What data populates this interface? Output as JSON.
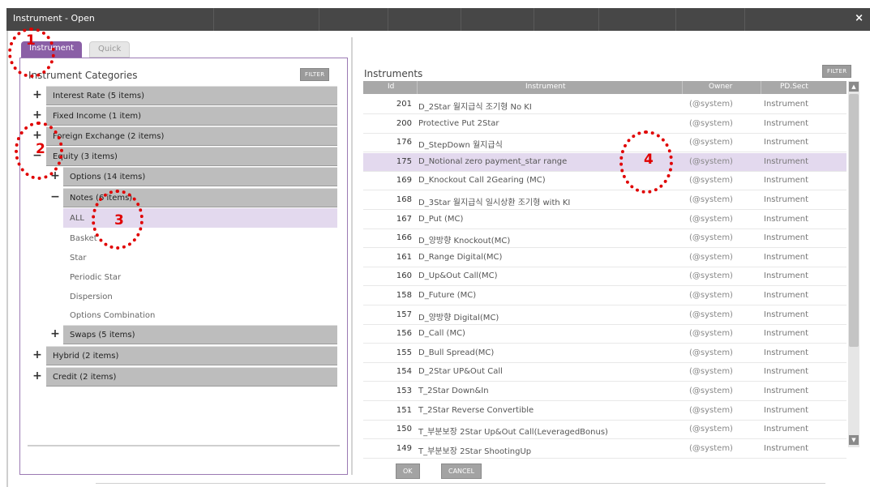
{
  "window": {
    "title": "Instrument - Open",
    "close_glyph": "×"
  },
  "tabs": [
    {
      "label": "Instrument"
    },
    {
      "label": "Quick"
    }
  ],
  "left": {
    "heading": "Instrument Categories",
    "filter_label": "FILTER",
    "tree": [
      {
        "label": "Interest Rate (5 items)",
        "expander": "+"
      },
      {
        "label": "Fixed Income (1 item)",
        "expander": "+"
      },
      {
        "label": "Foreign Exchange (2 items)",
        "expander": "+"
      },
      {
        "label": "Equity (3 items)",
        "expander": "−"
      },
      {
        "label": "Options (14 items)",
        "expander": "+"
      },
      {
        "label": "Notes (6 items)",
        "expander": "−"
      },
      {
        "label": "ALL"
      },
      {
        "label": "Basket"
      },
      {
        "label": "Star"
      },
      {
        "label": "Periodic Star"
      },
      {
        "label": "Dispersion"
      },
      {
        "label": "Options Combination"
      },
      {
        "label": "Swaps (5 items)",
        "expander": "+"
      },
      {
        "label": "Hybrid (2 items)",
        "expander": "+"
      },
      {
        "label": "Credit (2 items)",
        "expander": "+"
      }
    ]
  },
  "right": {
    "heading": "Instruments",
    "filter_label": "FILTER",
    "columns": [
      "Id",
      "Instrument",
      "Owner",
      "PD.Sect"
    ],
    "rows": [
      {
        "id": "201",
        "name": "D_2Star 월지급식 조기형 No KI",
        "owner": "(@system)",
        "sect": "Instrument"
      },
      {
        "id": "200",
        "name": "Protective Put 2Star",
        "owner": "(@system)",
        "sect": "Instrument"
      },
      {
        "id": "176",
        "name": "D_StepDown 월지급식",
        "owner": "(@system)",
        "sect": "Instrument"
      },
      {
        "id": "175",
        "name": "D_Notional zero payment_star range",
        "owner": "(@system)",
        "sect": "Instrument"
      },
      {
        "id": "169",
        "name": "D_Knockout Call 2Gearing (MC)",
        "owner": "(@system)",
        "sect": "Instrument"
      },
      {
        "id": "168",
        "name": "D_3Star 월지급식 일시상환 조기형 with KI",
        "owner": "(@system)",
        "sect": "Instrument"
      },
      {
        "id": "167",
        "name": "D_Put (MC)",
        "owner": "(@system)",
        "sect": "Instrument"
      },
      {
        "id": "166",
        "name": "D_양방향 Knockout(MC)",
        "owner": "(@system)",
        "sect": "Instrument"
      },
      {
        "id": "161",
        "name": "D_Range Digital(MC)",
        "owner": "(@system)",
        "sect": "Instrument"
      },
      {
        "id": "160",
        "name": "D_Up&Out Call(MC)",
        "owner": "(@system)",
        "sect": "Instrument"
      },
      {
        "id": "158",
        "name": "D_Future (MC)",
        "owner": "(@system)",
        "sect": "Instrument"
      },
      {
        "id": "157",
        "name": "D_양방향 Digital(MC)",
        "owner": "(@system)",
        "sect": "Instrument"
      },
      {
        "id": "156",
        "name": "D_Call (MC)",
        "owner": "(@system)",
        "sect": "Instrument"
      },
      {
        "id": "155",
        "name": "D_Bull Spread(MC)",
        "owner": "(@system)",
        "sect": "Instrument"
      },
      {
        "id": "154",
        "name": "D_2Star UP&Out Call",
        "owner": "(@system)",
        "sect": "Instrument"
      },
      {
        "id": "153",
        "name": "T_2Star Down&In",
        "owner": "(@system)",
        "sect": "Instrument"
      },
      {
        "id": "151",
        "name": "T_2Star Reverse Convertible",
        "owner": "(@system)",
        "sect": "Instrument"
      },
      {
        "id": "150",
        "name": "T_부분보장 2Star Up&Out Call(LeveragedBonus)",
        "owner": "(@system)",
        "sect": "Instrument"
      },
      {
        "id": "149",
        "name": "T_부분보장 2Star ShootingUp",
        "owner": "(@system)",
        "sect": "Instrument"
      }
    ],
    "scroll_up": "▲",
    "scroll_down": "▼"
  },
  "buttons": {
    "ok": "OK",
    "cancel": "CANCEL"
  },
  "annotations": [
    "1",
    "2",
    "3",
    "4"
  ]
}
